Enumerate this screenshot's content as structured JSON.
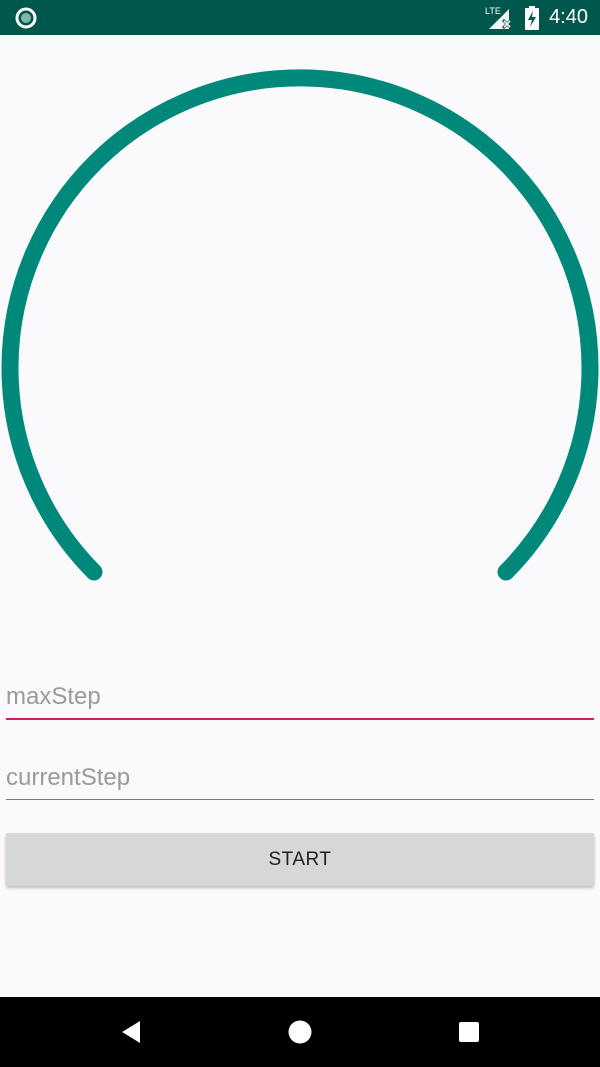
{
  "status_bar": {
    "time": "4:40",
    "network_label": "LTE",
    "left_icon": "circle-notification-icon",
    "signal_icon": "signal-lte-icon",
    "battery_icon": "battery-charging-icon"
  },
  "gauge": {
    "progress": 0,
    "track_color": "#00897b",
    "sweep_degrees": 270
  },
  "fields": {
    "max_step_placeholder": "maxStep",
    "current_step_placeholder": "currentStep",
    "max_step_value": "",
    "current_step_value": ""
  },
  "start_button": {
    "label": "START"
  },
  "colors": {
    "status_bar": "#00574b",
    "accent": "#d81b60",
    "gauge": "#00897b"
  },
  "nav_bar": {
    "back_icon": "back-triangle-icon",
    "home_icon": "home-circle-icon",
    "recents_icon": "recents-square-icon"
  }
}
